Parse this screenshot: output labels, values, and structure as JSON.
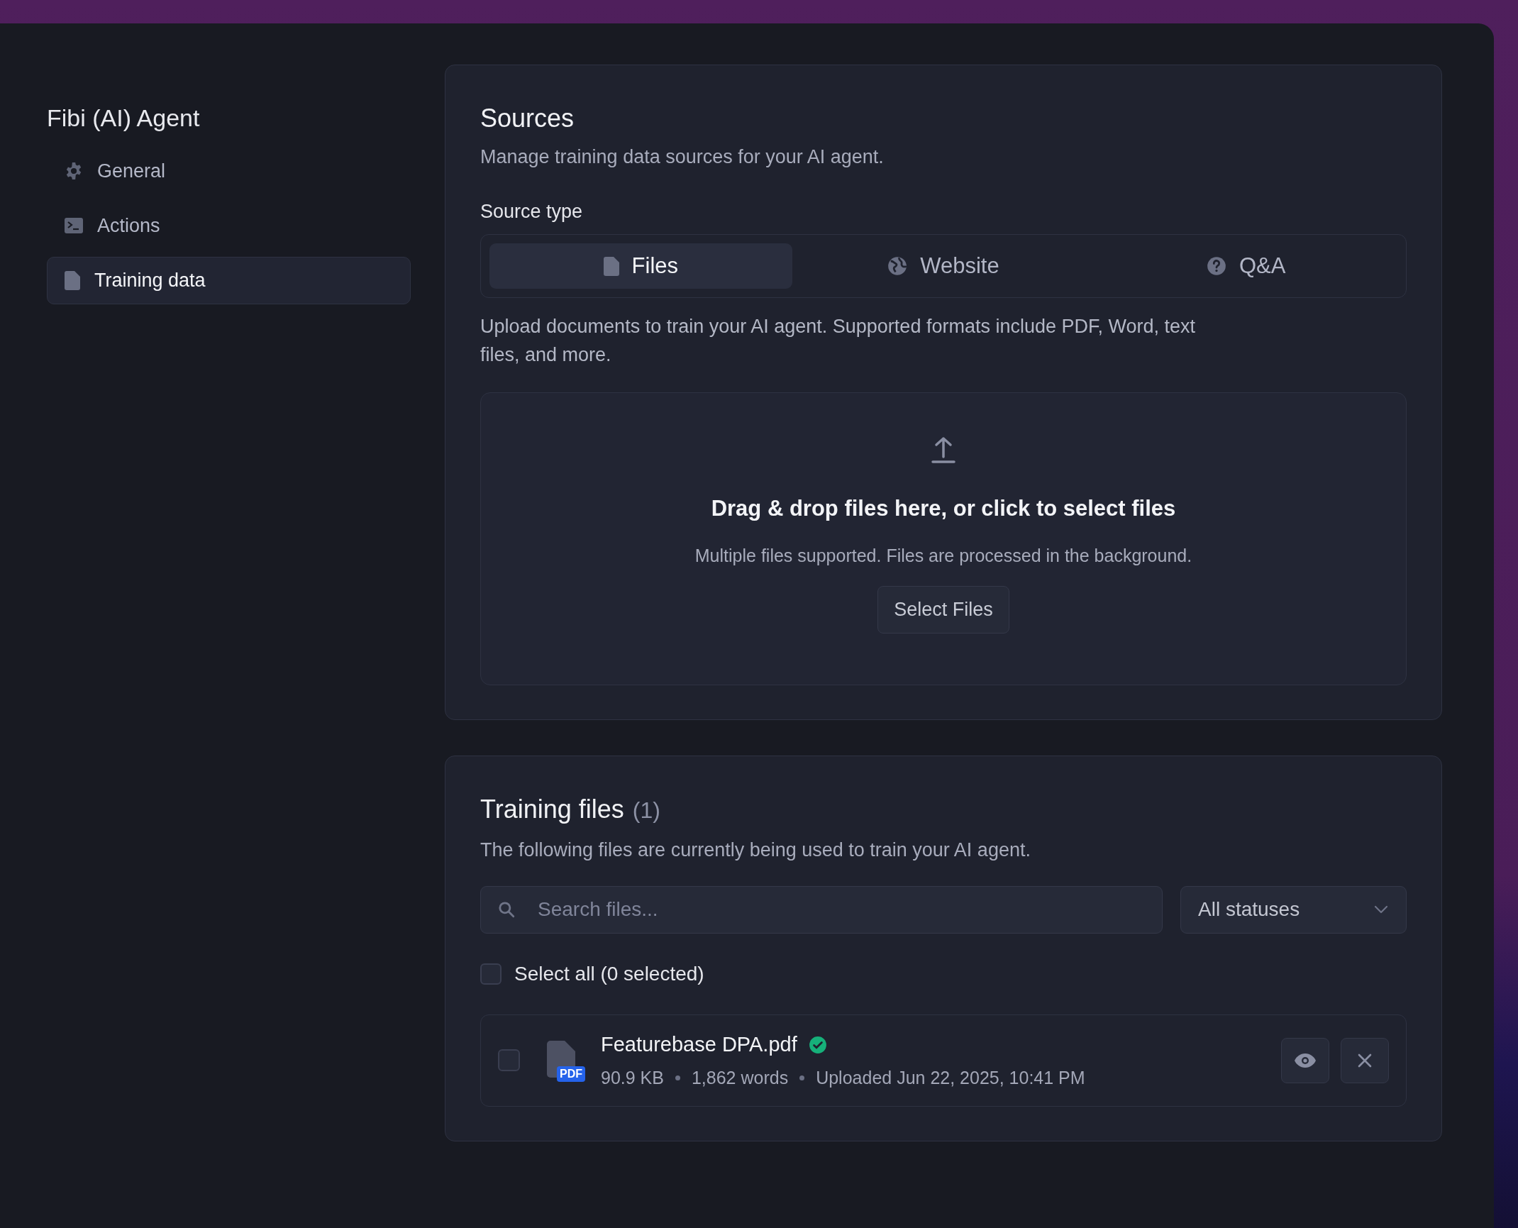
{
  "sidebar": {
    "title": "Fibi (AI) Agent",
    "items": [
      {
        "label": "General",
        "selected": false
      },
      {
        "label": "Actions",
        "selected": false
      },
      {
        "label": "Training data",
        "selected": true
      }
    ]
  },
  "sources": {
    "title": "Sources",
    "subtitle": "Manage training data sources for your AI agent.",
    "source_type_label": "Source type",
    "tabs": [
      {
        "label": "Files",
        "selected": true
      },
      {
        "label": "Website",
        "selected": false
      },
      {
        "label": "Q&A",
        "selected": false
      }
    ],
    "description": "Upload documents to train your AI agent. Supported formats include PDF, Word, text files, and more.",
    "dropzone": {
      "headline": "Drag & drop files here, or click to select files",
      "hint": "Multiple files supported. Files are processed in the background.",
      "button": "Select Files"
    }
  },
  "training_files": {
    "title": "Training files",
    "count": "(1)",
    "subtitle": "The following files are currently being used to train your AI agent.",
    "search": {
      "placeholder": "Search files..."
    },
    "status_filter": "All statuses",
    "select_all": {
      "label": "Select all (0 selected)",
      "checked": false
    },
    "files": [
      {
        "name": "Featurebase DPA.pdf",
        "type_badge": "PDF",
        "verified": true,
        "size": "90.9 KB",
        "words": "1,862 words",
        "uploaded": "Uploaded Jun 22, 2025, 10:41 PM",
        "checked": false
      }
    ]
  }
}
